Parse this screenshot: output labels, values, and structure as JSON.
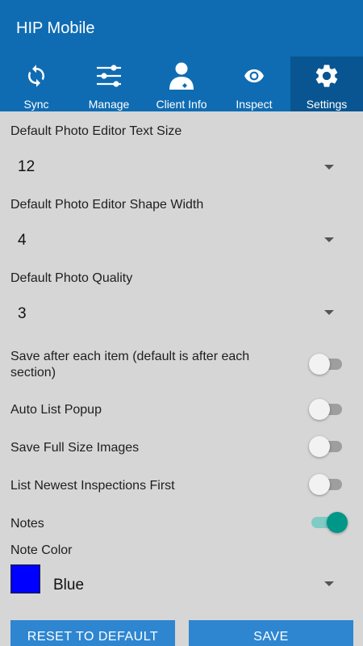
{
  "app": {
    "title": "HIP Mobile"
  },
  "tabs": [
    {
      "label": "Sync",
      "icon": "sync-icon"
    },
    {
      "label": "Manage",
      "icon": "sliders-icon"
    },
    {
      "label": "Client Info",
      "icon": "client-icon"
    },
    {
      "label": "Inspect",
      "icon": "eye-icon"
    },
    {
      "label": "Settings",
      "icon": "gear-icon",
      "active": true
    }
  ],
  "settings": {
    "text_size": {
      "label": "Default Photo Editor Text Size",
      "value": "12"
    },
    "shape_width": {
      "label": "Default Photo Editor Shape Width",
      "value": "4"
    },
    "photo_quality": {
      "label": "Default Photo Quality",
      "value": "3"
    },
    "toggles": [
      {
        "label": "Save after each item (default is after each section)",
        "on": false
      },
      {
        "label": "Auto List Popup",
        "on": false
      },
      {
        "label": "Save Full Size Images",
        "on": false
      },
      {
        "label": "List Newest Inspections First",
        "on": false
      },
      {
        "label": "Notes",
        "on": true
      }
    ],
    "note_color": {
      "label": "Note Color",
      "value": "Blue",
      "swatch": "#0000ff"
    }
  },
  "buttons": {
    "reset": "RESET TO DEFAULT",
    "save": "SAVE"
  },
  "colors": {
    "primary": "#0f6cb3",
    "active_tab": "#085591",
    "accent": "#009688",
    "button": "#2e86d1"
  }
}
